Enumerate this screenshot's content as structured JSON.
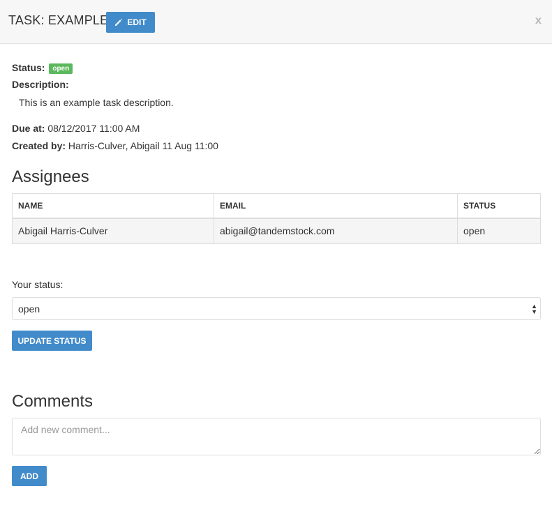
{
  "header": {
    "title": "TASK: EXAMPLE",
    "edit_label": "EDIT",
    "close_label": "x"
  },
  "details": {
    "status_label": "Status:",
    "status_value": "open",
    "description_label": "Description:",
    "description_text": "This is an example task description.",
    "due_label": "Due at:",
    "due_value": "08/12/2017 11:00 AM",
    "created_label": "Created by:",
    "created_value": "Harris-Culver, Abigail 11 Aug 11:00"
  },
  "assignees": {
    "heading": "Assignees",
    "columns": [
      "NAME",
      "EMAIL",
      "STATUS"
    ],
    "rows": [
      [
        "Abigail Harris-Culver",
        "abigail@tandemstock.com",
        "open"
      ]
    ]
  },
  "your_status": {
    "label": "Your status:",
    "selected": "open",
    "update_label": "UPDATE STATUS"
  },
  "comments": {
    "heading": "Comments",
    "placeholder": "Add new comment...",
    "add_label": "ADD"
  },
  "colors": {
    "primary": "#428bca",
    "status_open": "#5cb85c"
  },
  "icons": [
    "pencil-icon",
    "select-arrows-icon"
  ]
}
